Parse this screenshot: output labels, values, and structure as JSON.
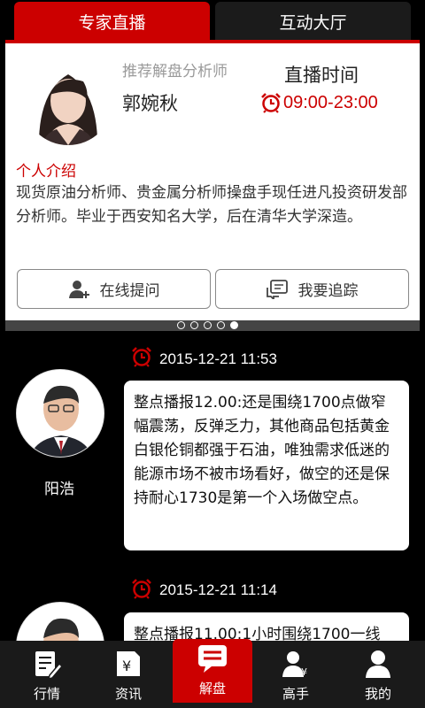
{
  "tabs": [
    {
      "label": "专家直播",
      "active": true
    },
    {
      "label": "互动大厅",
      "active": false
    }
  ],
  "analyst": {
    "subtitle": "推荐解盘分析师",
    "name": "郭婉秋",
    "live_title": "直播时间",
    "live_time": "09:00-23:00",
    "intro_title": "个人介绍",
    "intro_text": "现货原油分析师、贵金属分析师操盘手现任进凡投资研发部分析师。毕业于西安知名大学，后在清华大学深造。"
  },
  "actions": {
    "ask_label": "在线提问",
    "track_label": "我要追踪"
  },
  "pager": {
    "count": 5,
    "active_index": 4
  },
  "feed": [
    {
      "time": "2015-12-21 11:53",
      "author": "阳浩",
      "content": "整点播报12.00:还是围绕1700点做窄幅震荡，反弹乏力，其他商品包括黄金白银伦铜都强于石油，唯独需求低迷的能源市场不被市场看好，做空的还是保持耐心1730是第一个入场做空点。"
    },
    {
      "time": "2015-12-21 11:14",
      "author": "",
      "content": "整点播报11.00:1小时围绕1700一线"
    }
  ],
  "nav": [
    {
      "label": "行情",
      "icon": "market-icon"
    },
    {
      "label": "资讯",
      "icon": "news-icon"
    },
    {
      "label": "解盘",
      "icon": "analysis-icon",
      "active": true
    },
    {
      "label": "高手",
      "icon": "expert-icon"
    },
    {
      "label": "我的",
      "icon": "profile-icon"
    }
  ],
  "colors": {
    "accent": "#cc0000",
    "background": "#000000",
    "nav": "#1a1a1a"
  }
}
